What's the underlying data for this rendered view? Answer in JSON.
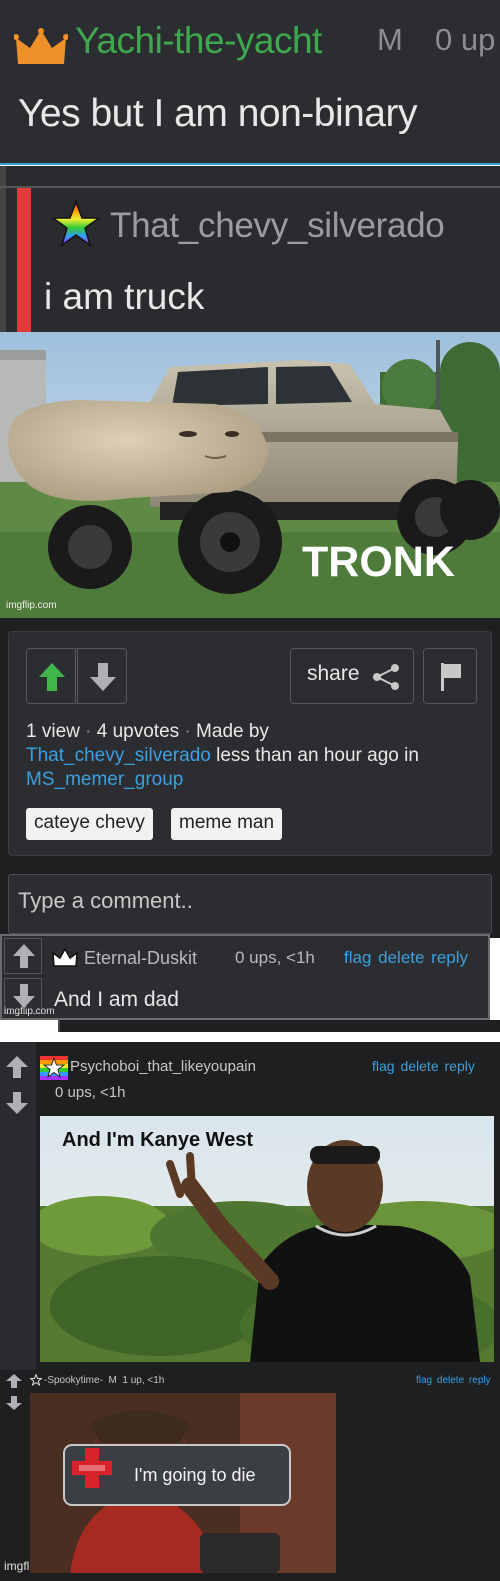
{
  "panel1": {
    "username": "Yachi-the-yacht",
    "mod_badge": "M",
    "upvotes": "0 up",
    "text": "Yes but I am non-binary",
    "icon": "crown-icon",
    "icon_color": "#f0902a"
  },
  "panel2": {
    "username": "That_chevy_silverado",
    "text": "i am truck",
    "icon": "rainbow-star-icon"
  },
  "post": {
    "image_caption": "TRONK",
    "image_watermark": "imgflip.com",
    "share_label": "share",
    "views": "1 view",
    "upvotes": "4 upvotes",
    "made_by_label": "Made by",
    "author": "That_chevy_silverado",
    "time_text": "less than an hour ago in",
    "stream": "MS_memer_group",
    "tags": [
      "cateye chevy",
      "meme man"
    ],
    "accent_color": "#3ba0e0",
    "upvote_color": "#3fb54a"
  },
  "comment_box": {
    "placeholder": "Type a comment.."
  },
  "comment_dad": {
    "username": "Eternal-Duskit",
    "meta": "0 ups, <1h",
    "actions": "flag delete reply",
    "text": "And I am dad",
    "watermark": "imgflip.com",
    "icon": "crown-icon"
  },
  "comment_kanye": {
    "username": "Psychoboi_that_likeyoupain",
    "meta": "0 ups, <1h",
    "actions": "flag delete reply",
    "image_caption": "And I'm Kanye West",
    "icon": "rainbow-star-icon"
  },
  "comment_spooky": {
    "username": "-Spookytime-",
    "mod_badge": "M",
    "meta": "1 up, <1h",
    "actions": "flag delete reply",
    "image_text": "I'm going to die",
    "watermark": "imgflip.com",
    "icon": "star-outline-icon"
  }
}
